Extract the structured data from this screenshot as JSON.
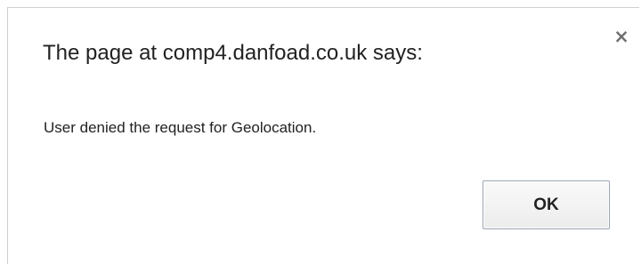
{
  "dialog": {
    "title": "The page at comp4.danfoad.co.uk says:",
    "message": "User denied the request for Geolocation.",
    "close_glyph": "×",
    "close_icon": "close-icon",
    "ok_label": "OK"
  }
}
